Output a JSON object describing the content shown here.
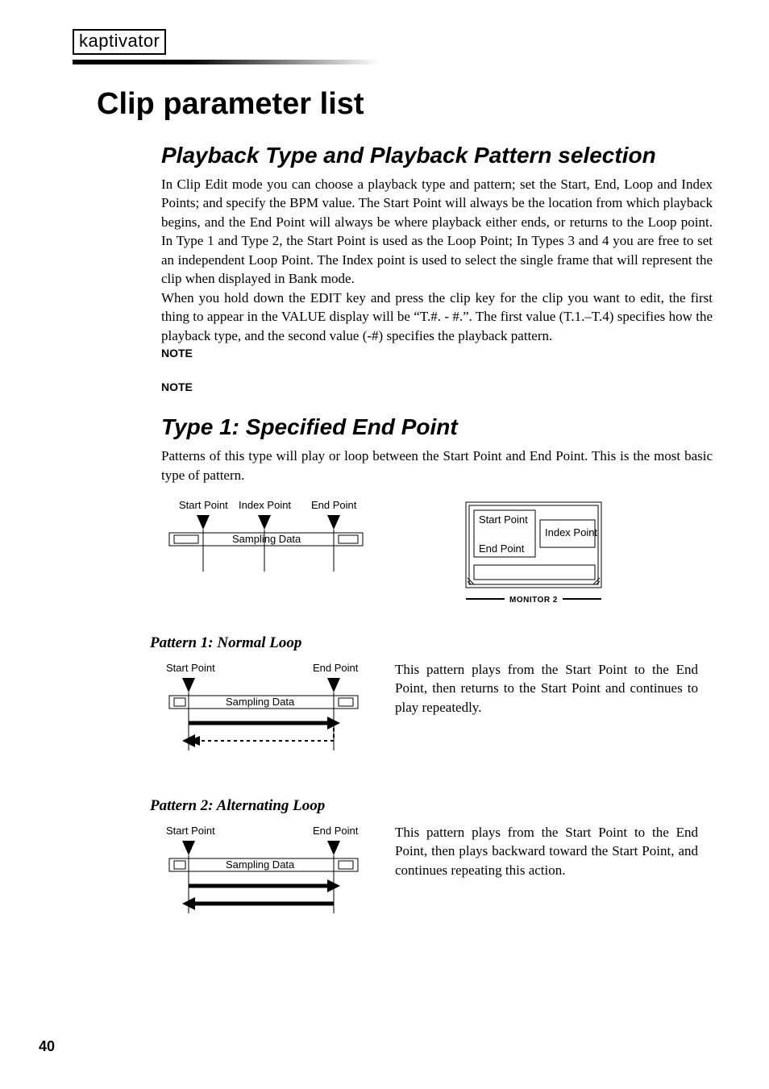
{
  "brand": "kaptivator",
  "h1": "Clip parameter list",
  "section1": {
    "title": "Playback Type and Playback Pattern selection",
    "para1": "In Clip Edit mode you can choose a playback type and pattern; set the Start, End, Loop and Index Points; and specify the BPM value. The Start Point will always be the location from which playback begins, and the End Point will always be where playback either ends, or returns to the Loop point. In Type 1 and Type 2, the Start Point is used as the Loop Point; In Types 3 and 4 you are free to set an independent Loop Point. The Index point is used to select the single frame that will represent the clip when displayed in Bank mode.",
    "para2": "When you hold down the EDIT key and press the clip key for the clip you want to edit, the first thing to appear in the VALUE display will be “T.#. - #.”. The first value (T.1.–T.4) specifies how the playback type, and the second value (-#) specifies the playback pattern.",
    "note1": "NOTE",
    "note2": "NOTE"
  },
  "section2": {
    "title": "Type 1: Specified End Point",
    "para": "Patterns of this type will play or loop between the Start Point and End Point. This is the most basic type of pattern."
  },
  "diagram_overview": {
    "start": "Start Point",
    "index": "Index Point",
    "end": "End Point",
    "sampling": "Sampling Data"
  },
  "monitor": {
    "box_start": "Start Point",
    "box_index": "Index Point",
    "box_end": "End Point",
    "label": "MONITOR 2"
  },
  "pattern1": {
    "title": "Pattern 1: Normal Loop",
    "start": "Start Point",
    "end": "End Point",
    "sampling": "Sampling Data",
    "desc": "This pattern plays from the Start Point to the End Point, then returns to the Start Point and continues to play repeatedly."
  },
  "pattern2": {
    "title": "Pattern 2: Alternating Loop",
    "start": "Start Point",
    "end": "End Point",
    "sampling": "Sampling Data",
    "desc": "This pattern plays from the Start Point to the End Point, then plays backward toward the Start Point, and continues repeating this action."
  },
  "page_number": "40"
}
